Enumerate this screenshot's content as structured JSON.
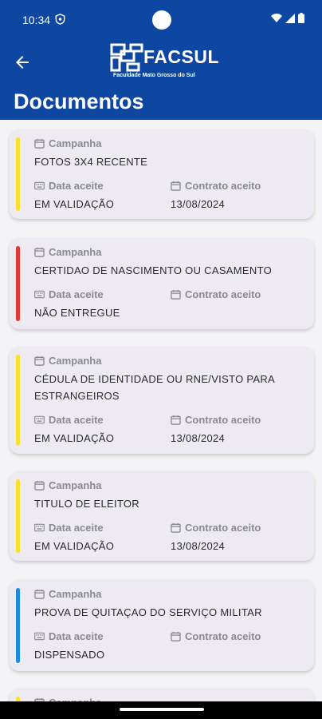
{
  "status": {
    "time": "10:34"
  },
  "header": {
    "logo_text": "FACSUL",
    "logo_subtitle": "Faculdade Mato Grosso do Sul",
    "title": "Documentos"
  },
  "labels": {
    "campaign": "Campanha",
    "accepted_date": "Data aceite",
    "contract_accepted": "Contrato aceito"
  },
  "colors": {
    "header": "#0d47a1",
    "pending_validation": "#fbe02a",
    "not_delivered": "#e53935",
    "exempt": "#1e88e5"
  },
  "documents": [
    {
      "campaign": "FOTOS 3X4 RECENTE",
      "status": "EM VALIDAÇÃO",
      "contract_date": "13/08/2024",
      "status_color": "#fbe02a"
    },
    {
      "campaign": "CERTIDAO DE NASCIMENTO OU CASAMENTO",
      "status": "NÃO ENTREGUE",
      "contract_date": "",
      "status_color": "#e53935"
    },
    {
      "campaign": "CÉDULA DE IDENTIDADE OU RNE/VISTO PARA ESTRANGEIROS",
      "status": "EM VALIDAÇÃO",
      "contract_date": "13/08/2024",
      "status_color": "#fbe02a"
    },
    {
      "campaign": "TITULO DE ELEITOR",
      "status": "EM VALIDAÇÃO",
      "contract_date": "13/08/2024",
      "status_color": "#fbe02a"
    },
    {
      "campaign": "PROVA DE QUITAÇAO DO SERVIÇO MILITAR",
      "status": "DISPENSADO",
      "contract_date": "",
      "status_color": "#1e88e5"
    },
    {
      "campaign": "",
      "status": "",
      "contract_date": "",
      "status_color": "#fbe02a"
    }
  ]
}
